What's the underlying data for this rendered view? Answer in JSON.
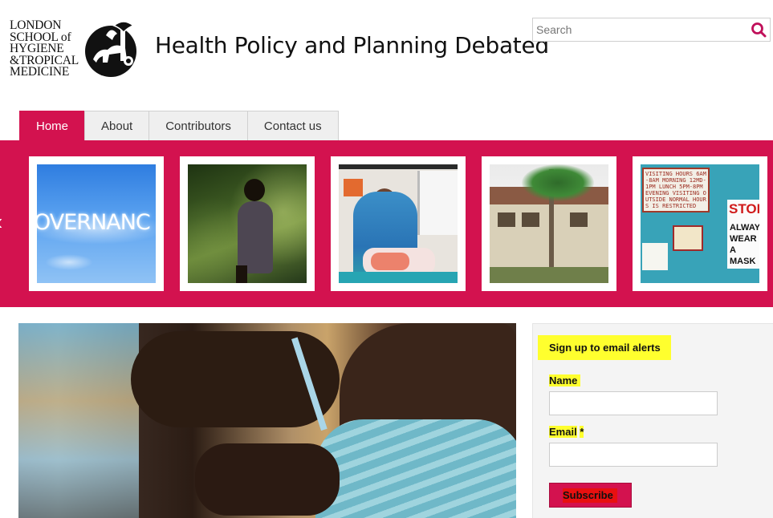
{
  "logo": {
    "lines": [
      "LONDON",
      "SCHOOL of",
      "HYGIENE",
      "&TROPICAL",
      "MEDICINE"
    ],
    "crest_icon": "lshtm-crest-icon"
  },
  "site_title": "Health Policy and Planning Debated",
  "search": {
    "placeholder": "Search",
    "icon": "search-icon"
  },
  "nav": {
    "tabs": [
      {
        "label": "Home",
        "active": true
      },
      {
        "label": "About",
        "active": false
      },
      {
        "label": "Contributors",
        "active": false
      },
      {
        "label": "Contact us",
        "active": false
      }
    ]
  },
  "banner": {
    "accent_color": "#d3124f",
    "prev_arrow": "‹",
    "thumbs": [
      {
        "name": "governance-cloud-text",
        "caption": "OVERNANC"
      },
      {
        "name": "child-in-forest"
      },
      {
        "name": "mother-with-newborn"
      },
      {
        "name": "health-centre-building"
      },
      {
        "name": "hospital-signs",
        "sign_text": "VISITING HOURS 6AM-8AM MORNING 12MD-1PM LUNCH 5PM-8PM EVENING VISITING OUTSIDE NORMAL HOURS IS RESTRICTED",
        "stop_text": "STOP",
        "mask_text": "ALWAYS WEAR A MASK"
      }
    ]
  },
  "main_image": {
    "name": "child-vaccination-photo"
  },
  "sidebar": {
    "title": "Sign up to email alerts",
    "name_label": "Name",
    "email_label": "Email",
    "required_mark": "*",
    "subscribe_label": "Subscribe"
  }
}
